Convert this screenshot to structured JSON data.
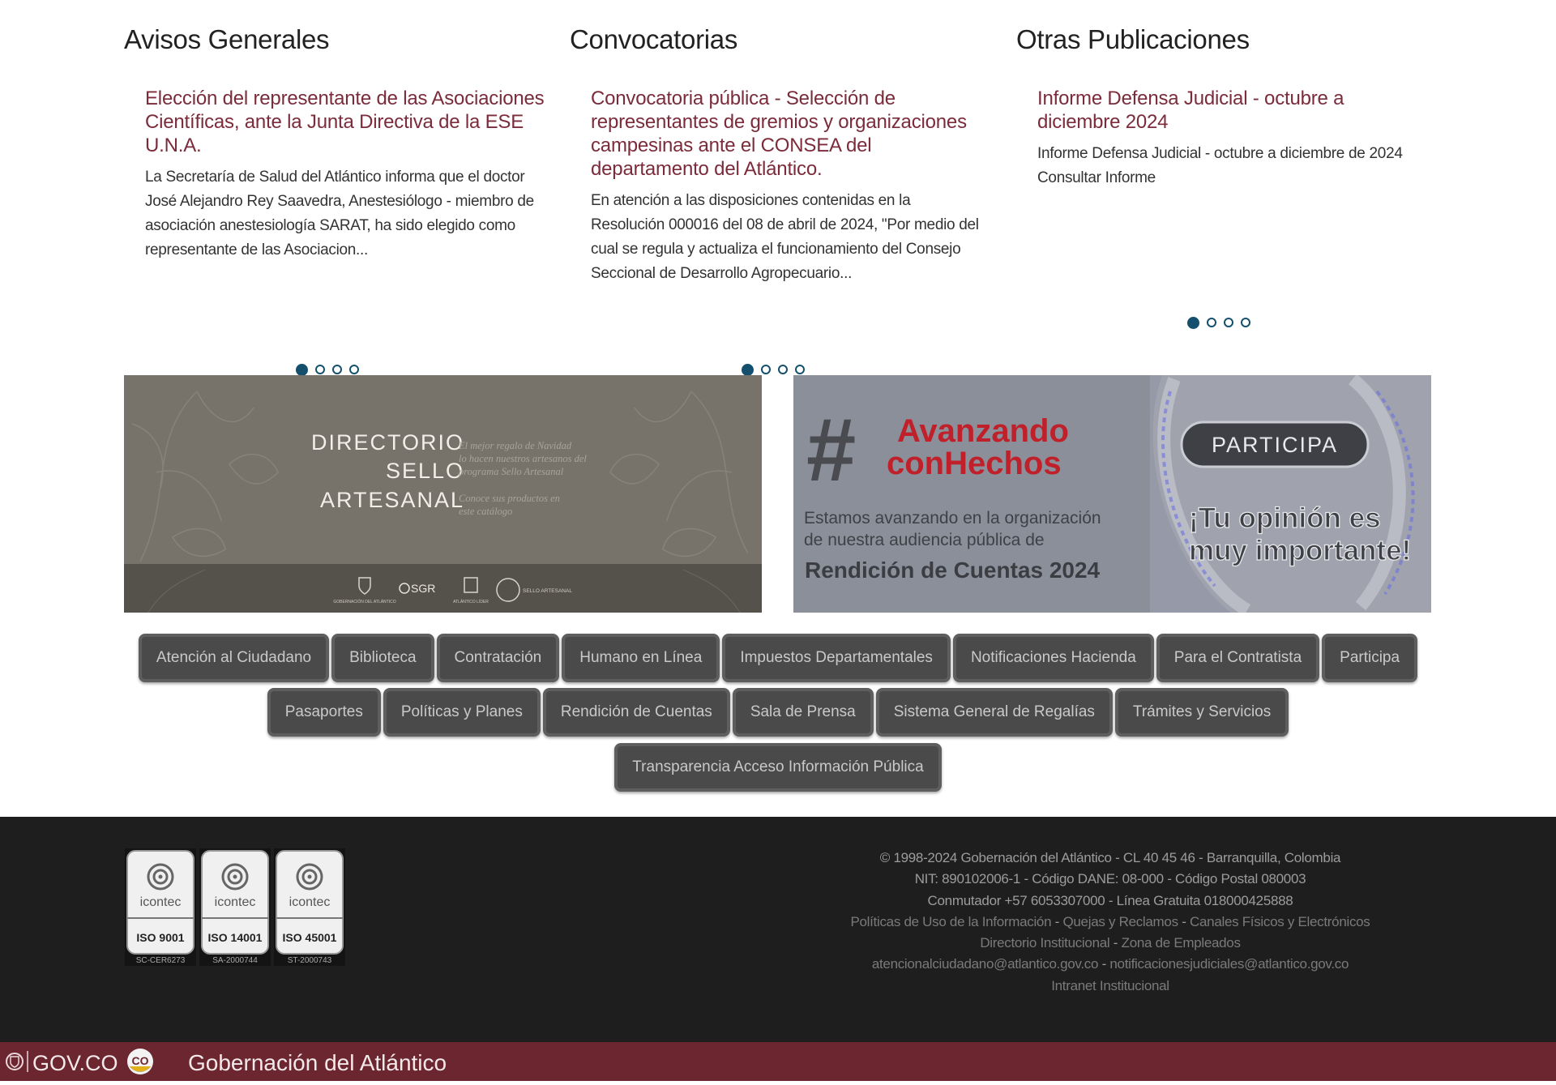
{
  "columns": [
    {
      "heading": "Avisos Generales",
      "item_title": "Elección del representante de las Asociaciones Científicas, ante la Junta Directiva de la ESE U.N.A.",
      "item_text": "La Secretaría de Salud del Atlántico informa que el doctor José Alejandro Rey Saavedra, Anestesiólogo - miembro de asociación anestesiología SARAT, ha sido elegido como representante de las Asociacion...",
      "active_slide": 1,
      "slide_count": 4
    },
    {
      "heading": "Convocatorias",
      "item_title": "Convocatoria pública - Selección de representantes de gremios y organizaciones campesinas ante el CONSEA del departamento del Atlántico.",
      "item_text": "En atención a las disposiciones contenidas en la Resolución 000016 del 08 de abril de 2024, \"Por medio del cual se regula y actualiza el funcionamiento del Consejo Seccional de Desarrollo Agropecuario...",
      "active_slide": 1,
      "slide_count": 4
    },
    {
      "heading": "Otras Publicaciones",
      "item_title": "Informe Defensa Judicial - octubre a diciembre 2024",
      "item_text": "Informe Defensa Judicial - octubre a diciembre de 2024 Consultar Informe",
      "active_slide": 1,
      "slide_count": 4
    }
  ],
  "banner_left": {
    "title_lines": [
      "DIRECTORIO",
      "SELLO",
      "ARTESANAL"
    ],
    "tagline_lines": [
      "El mejor regalo de Navidad",
      "lo hacen nuestros artesanos del",
      "programa Sello Artesanal"
    ],
    "cta_lines": [
      "Conoce sus productos en",
      "este catálogo"
    ],
    "logos": [
      "GOBERNACIÓN DEL ATLÁNTICO",
      "SGR",
      "ATLÁNTICO LÍDER",
      "SELLO ARTESANAL"
    ]
  },
  "banner_right": {
    "hashtag": "#",
    "headline_lines": [
      "Avanzando",
      "conHechos"
    ],
    "text_lines": [
      "Estamos avanzando en la organización",
      "de nuestra audiencia pública de"
    ],
    "strong_text": "Rendición de Cuentas 2024",
    "button_label": "PARTICIPA",
    "opinion_lines": [
      "¡Tu opinión es",
      "muy importante!"
    ]
  },
  "quick_links": [
    [
      "Atención al Ciudadano",
      "Biblioteca",
      "Contratación",
      "Humano en Línea",
      "Impuestos Departamentales",
      "Notificaciones Hacienda",
      "Para el Contratista",
      "Participa"
    ],
    [
      "Pasaportes",
      "Políticas y Planes",
      "Rendición de Cuentas",
      "Sala de Prensa",
      "Sistema General de Regalías",
      "Trámites y Servicios"
    ],
    [
      "Transparencia Acceso Información Pública"
    ]
  ],
  "footer": {
    "certifications": [
      {
        "brand": "icontec",
        "standard": "ISO 9001",
        "code": "SC-CER6273"
      },
      {
        "brand": "icontec",
        "standard": "ISO 14001",
        "code": "SA-2000744"
      },
      {
        "brand": "icontec",
        "standard": "ISO 45001",
        "code": "ST-2000743"
      }
    ],
    "copyright": "© 1998-2024 Gobernación del Atlántico - CL 40 45 46 - Barranquilla, Colombia",
    "ids": "NIT: 890102006-1 - Código DANE: 08-000 - Código Postal 080003",
    "phones": "Conmutador +57 6053307000 - Línea Gratuita 018000425888",
    "sep": "-",
    "links": {
      "politicas": "Políticas de Uso de la Información",
      "quejas": "Quejas y Reclamos",
      "canales": "Canales Físicos y Electrónicos",
      "directorio": "Directorio Institucional",
      "zona": "Zona de Empleados",
      "email_ciudadano": "atencionalciudadano@atlantico.gov.co",
      "email_notif": "notificacionesjudiciales@atlantico.gov.co",
      "intranet": "Intranet Institucional"
    }
  },
  "gov_bar": {
    "brand": "GOV.CO",
    "badge": "CO",
    "entity": "Gobernación del Atlántico"
  },
  "colors": {
    "link_title": "#7b2b3a",
    "dot": "#14506e",
    "footer_bg": "#1e1e1e",
    "gov_bar_bg": "#6b2630",
    "banner_red": "#c0202a"
  }
}
